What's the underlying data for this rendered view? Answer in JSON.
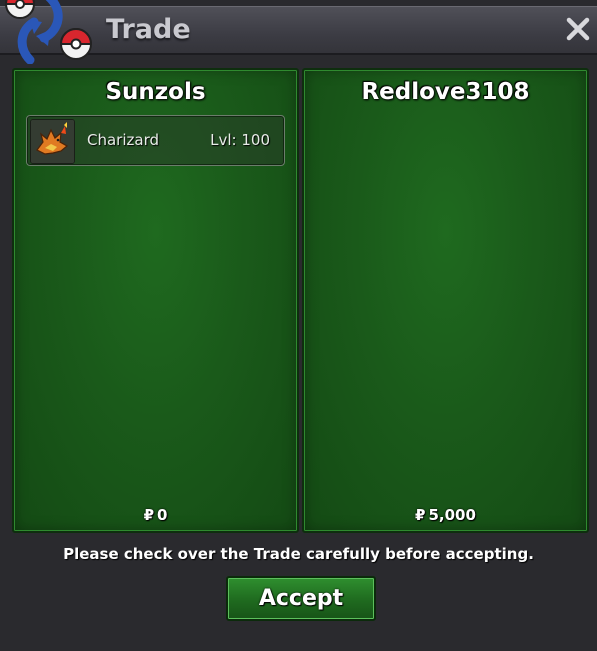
{
  "window": {
    "title": "Trade",
    "close_symbol": "✕"
  },
  "trade": {
    "left": {
      "player": "Sunzols",
      "currency_symbol": "₽",
      "money": "0",
      "pokemon": [
        {
          "name": "Charizard",
          "level": "Lvl: 100",
          "icon": "charizard-icon"
        }
      ]
    },
    "right": {
      "player": "Redlove3108",
      "currency_symbol": "₽",
      "money": "5,000",
      "pokemon": []
    }
  },
  "notice": "Please check over the Trade carefully before accepting.",
  "accept_label": "Accept",
  "colors": {
    "panel_green": "#1a5a1a",
    "button_green": "#1f6a1f",
    "titlebar": "#3c3c44",
    "pokeball_red": "#d8262e",
    "arrow_blue": "#2a57b8"
  }
}
